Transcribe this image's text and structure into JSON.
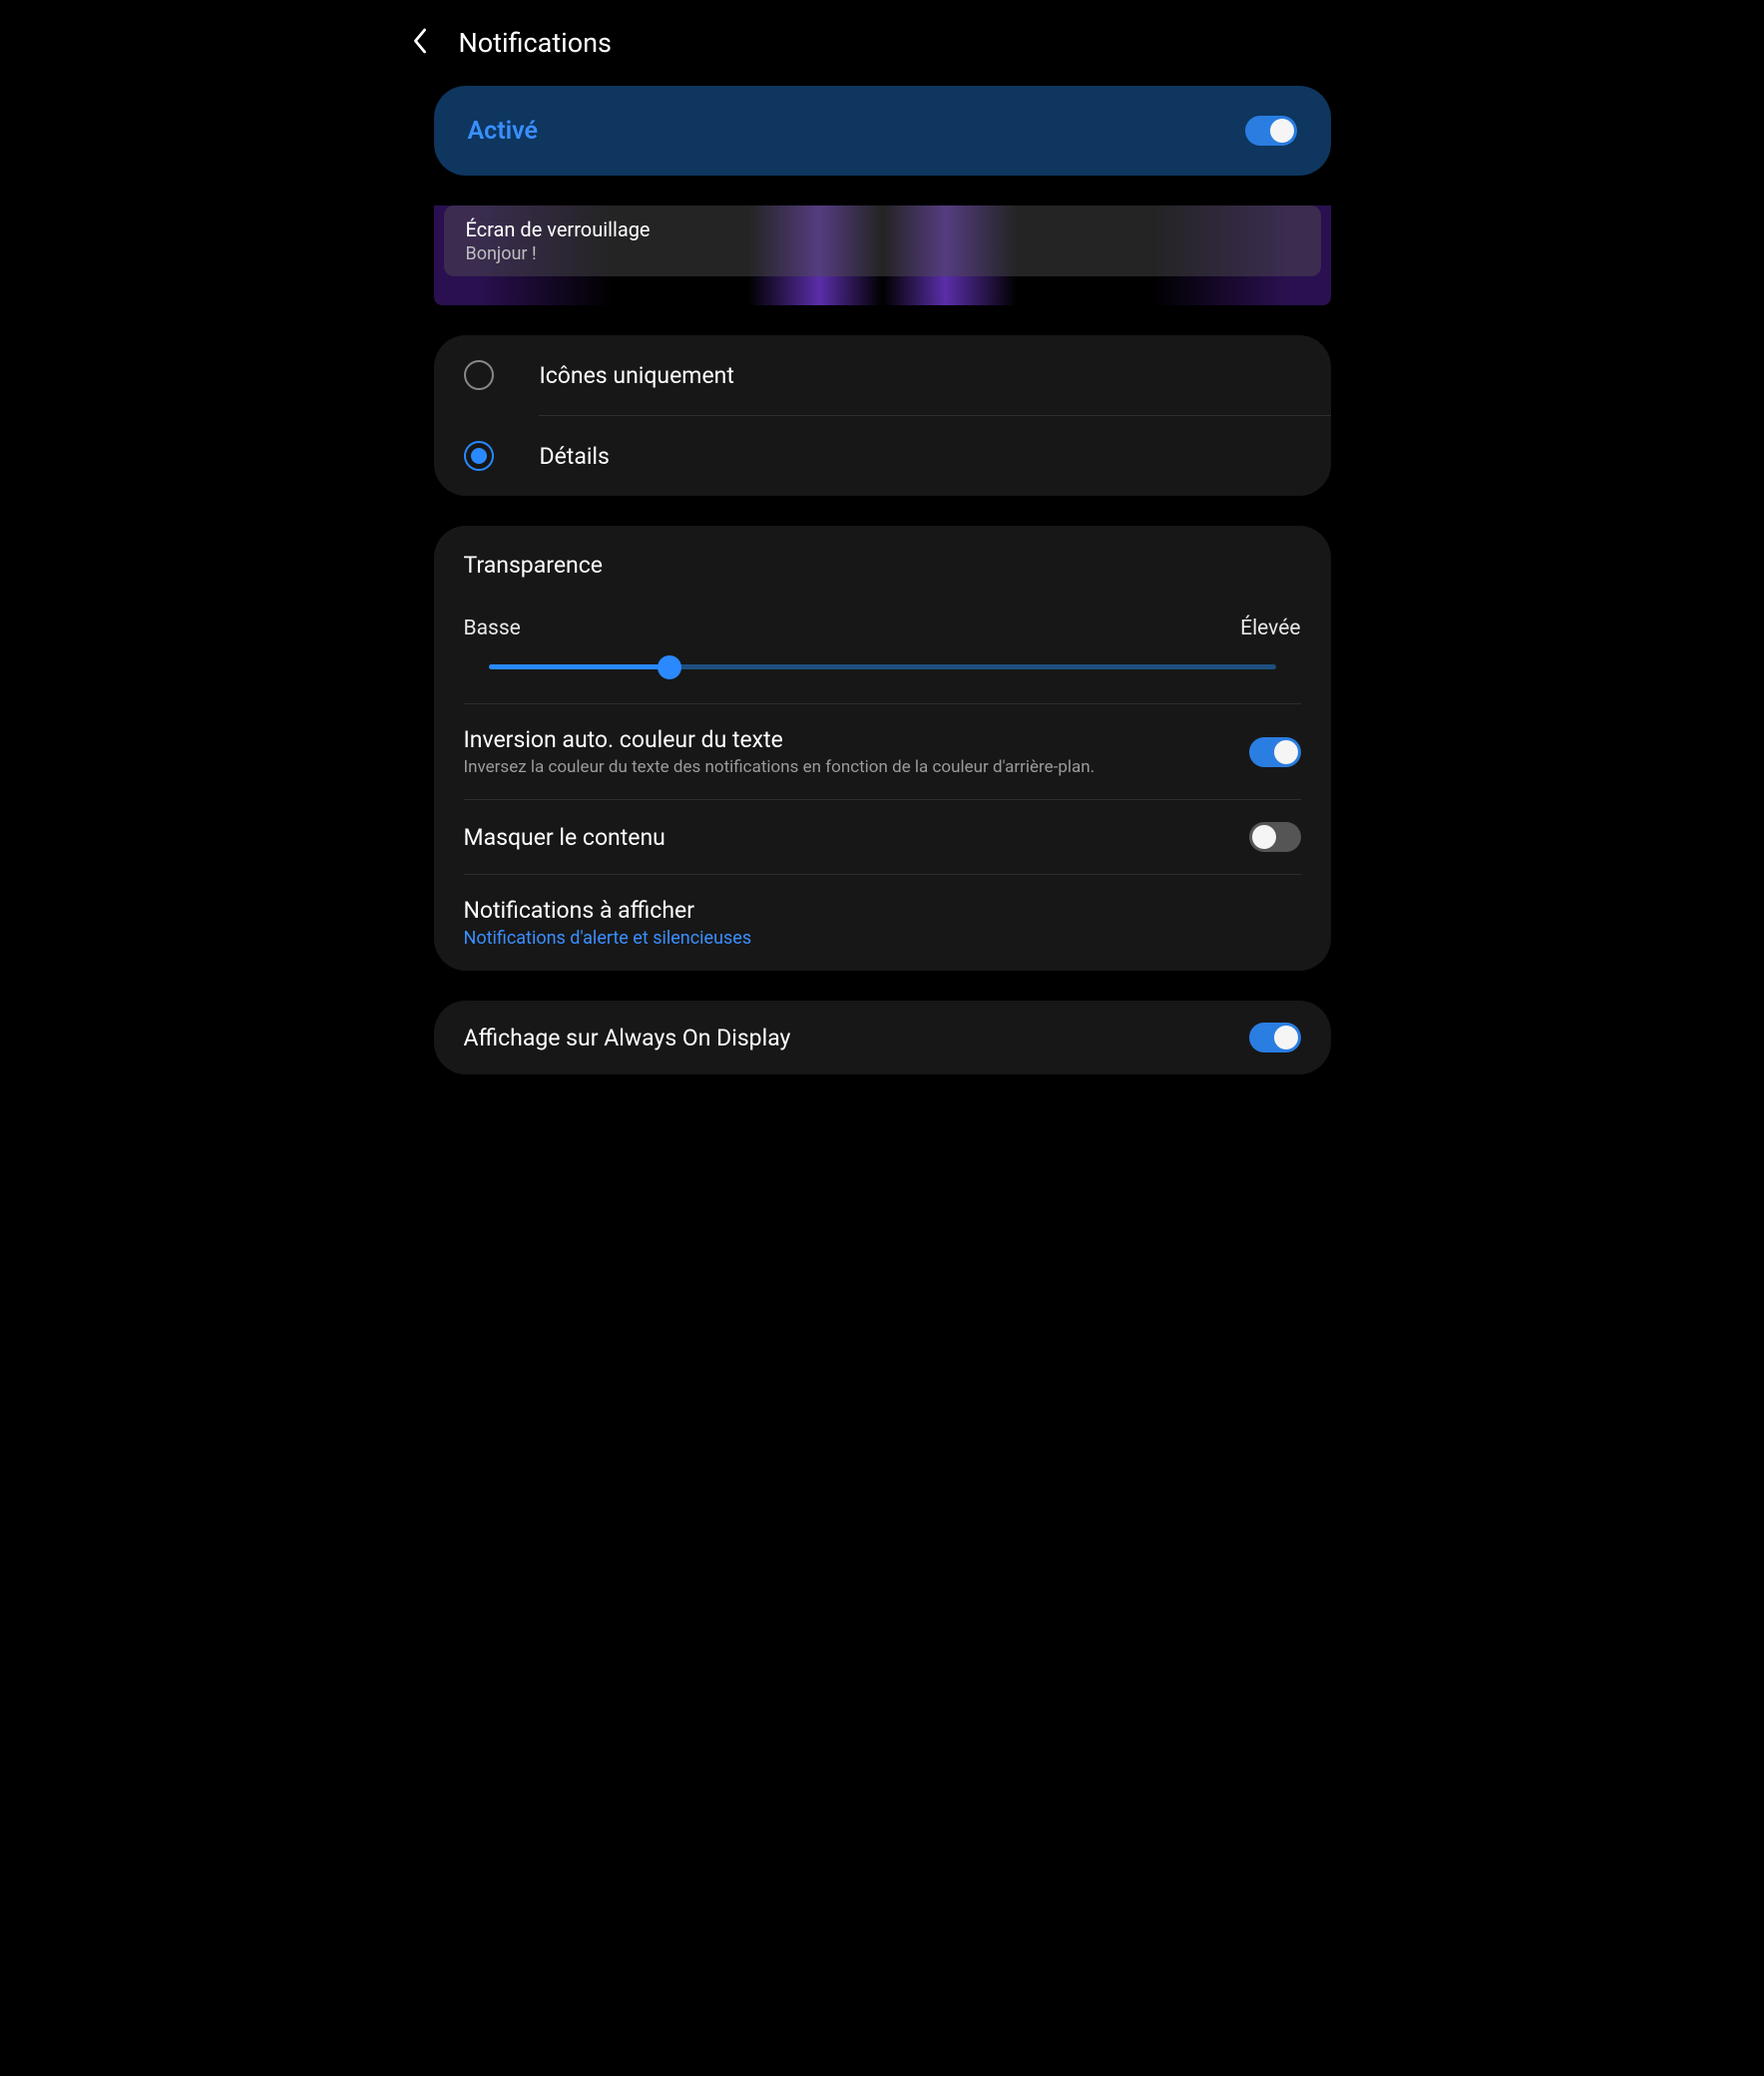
{
  "header": {
    "title": "Notifications"
  },
  "master": {
    "label": "Activé",
    "on": true
  },
  "preview": {
    "title": "Écran de verrouillage",
    "subtitle": "Bonjour !"
  },
  "style": {
    "icons_only": "Icônes uniquement",
    "details": "Détails",
    "selected": "details"
  },
  "transparency": {
    "title": "Transparence",
    "low": "Basse",
    "high": "Élevée",
    "value_pct": 23
  },
  "invert": {
    "title": "Inversion auto. couleur du texte",
    "sub": "Inversez la couleur du texte des notifications en fonction de la couleur d'arrière-plan.",
    "on": true
  },
  "hide_content": {
    "title": "Masquer le contenu",
    "on": false
  },
  "to_show": {
    "title": "Notifications à afficher",
    "sub": "Notifications d'alerte et silencieuses"
  },
  "aod": {
    "title": "Affichage sur Always On Display",
    "on": true
  }
}
